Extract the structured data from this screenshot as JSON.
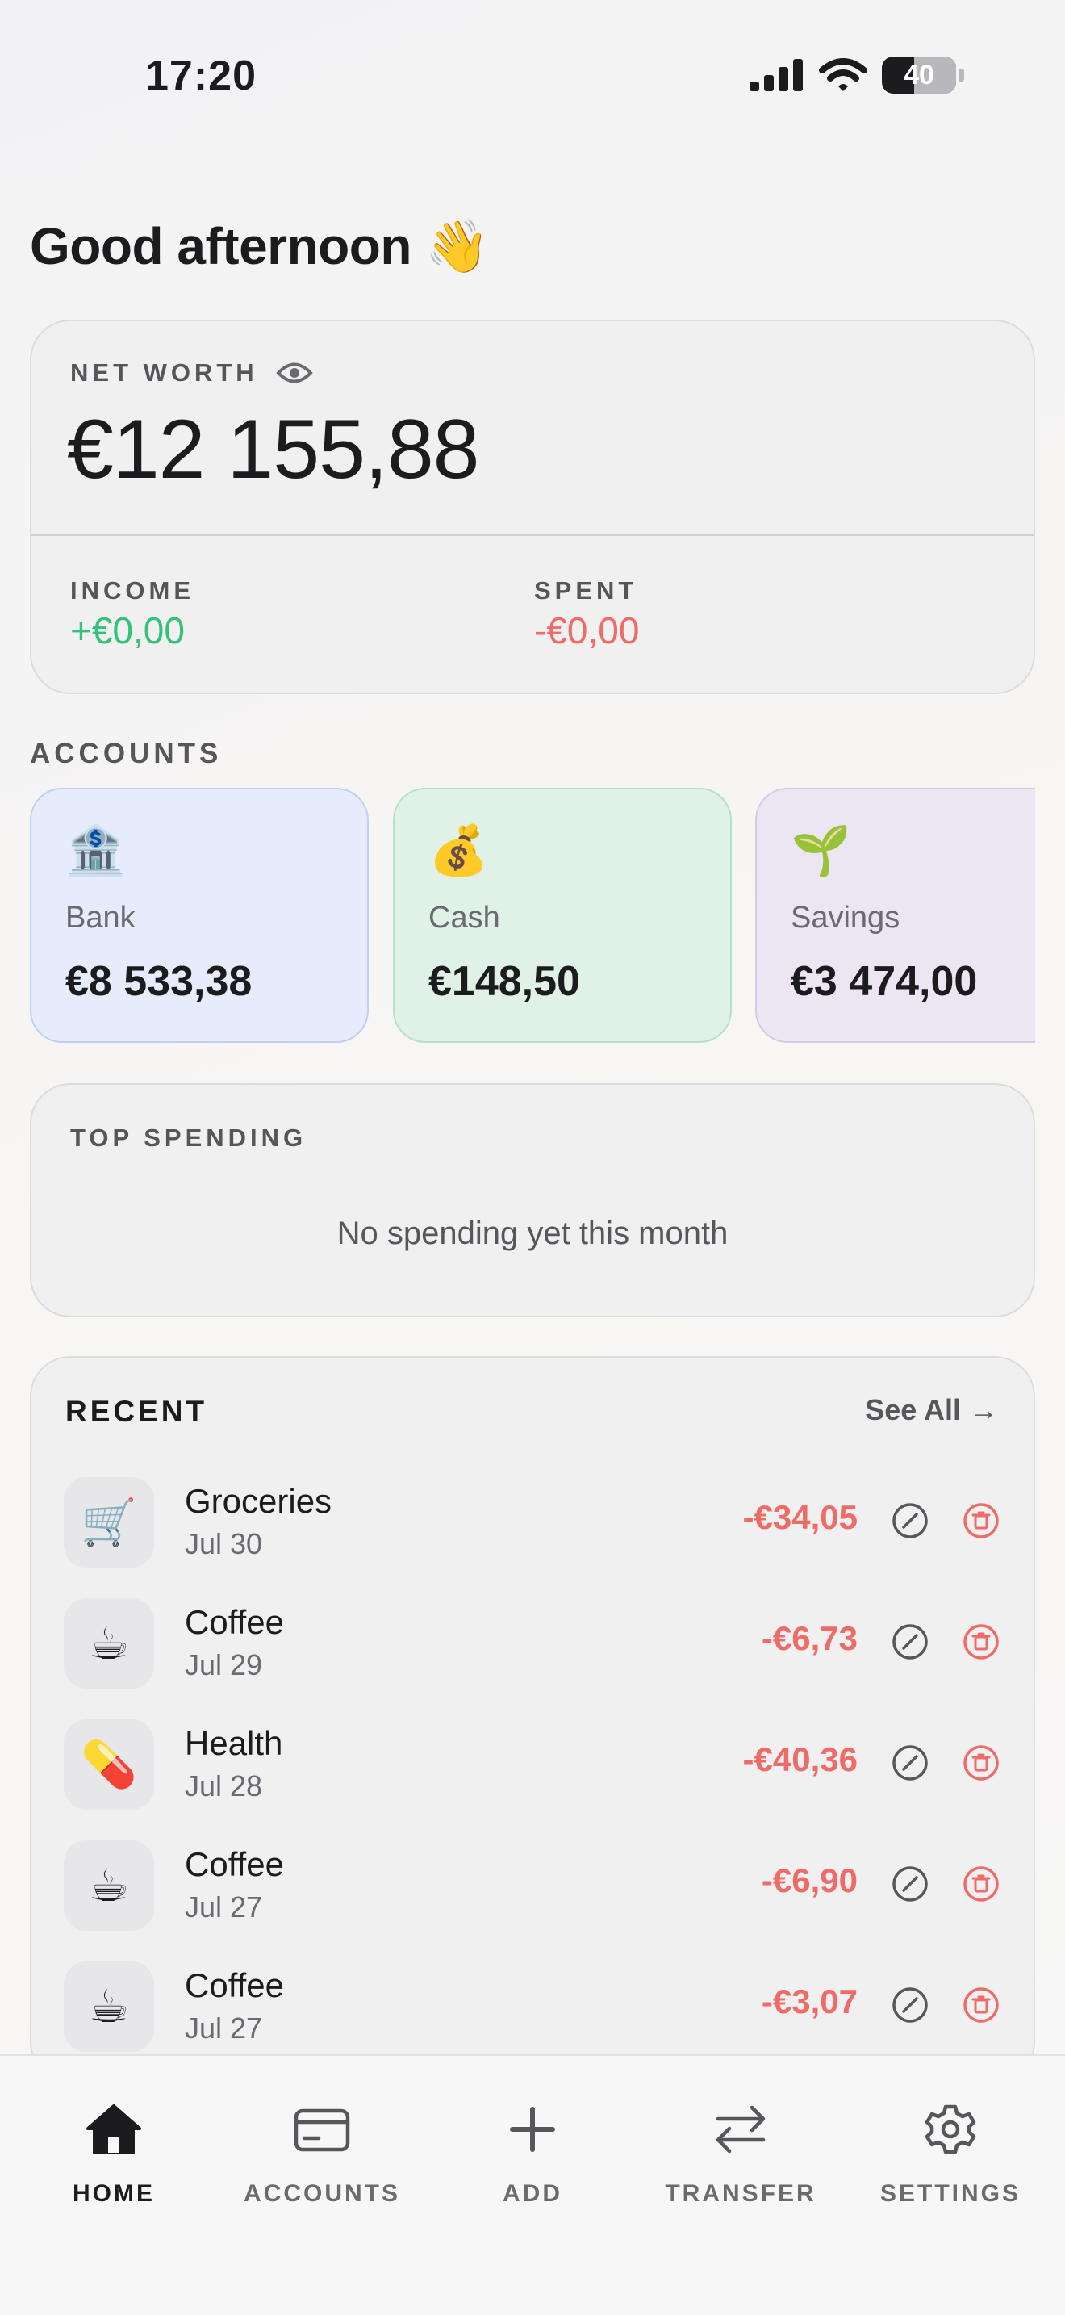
{
  "status_bar": {
    "time": "17:20",
    "battery": "40"
  },
  "greeting": "Good afternoon 👋",
  "net_worth": {
    "label": "NET WORTH",
    "value": "€12 155,88",
    "income_label": "INCOME",
    "income_value": "+€0,00",
    "spent_label": "SPENT",
    "spent_value": "-€0,00"
  },
  "accounts": {
    "label": "ACCOUNTS",
    "items": [
      {
        "emoji": "🏦",
        "name": "Bank",
        "balance": "€8 533,38"
      },
      {
        "emoji": "💰",
        "name": "Cash",
        "balance": "€148,50"
      },
      {
        "emoji": "🌱",
        "name": "Savings",
        "balance": "€3 474,00"
      }
    ]
  },
  "top_spending": {
    "label": "TOP SPENDING",
    "empty_text": "No spending yet this month"
  },
  "recent": {
    "title": "RECENT",
    "see_all": "See All →",
    "items": [
      {
        "emoji": "🛒",
        "name": "Groceries",
        "date": "Jul 30",
        "amount": "-€34,05"
      },
      {
        "emoji": "☕",
        "name": "Coffee",
        "date": "Jul 29",
        "amount": "-€6,73"
      },
      {
        "emoji": "💊",
        "name": "Health",
        "date": "Jul 28",
        "amount": "-€40,36"
      },
      {
        "emoji": "☕",
        "name": "Coffee",
        "date": "Jul 27",
        "amount": "-€6,90"
      },
      {
        "emoji": "☕",
        "name": "Coffee",
        "date": "Jul 27",
        "amount": "-€3,07"
      }
    ]
  },
  "tabs": [
    {
      "label": "HOME",
      "icon": "house-icon",
      "active": true
    },
    {
      "label": "ACCOUNTS",
      "icon": "card-icon",
      "active": false
    },
    {
      "label": "ADD",
      "icon": "plus-icon",
      "active": false
    },
    {
      "label": "TRANSFER",
      "icon": "transfer-arrows-icon",
      "active": false
    },
    {
      "label": "SETTINGS",
      "icon": "gear-icon",
      "active": false
    }
  ],
  "colors": {
    "income": "#34c27a",
    "expense": "#ef6b67",
    "bank_bg": "#e6ecfb",
    "cash_bg": "#e0f1e7",
    "savings_bg": "#ebe6f2"
  }
}
